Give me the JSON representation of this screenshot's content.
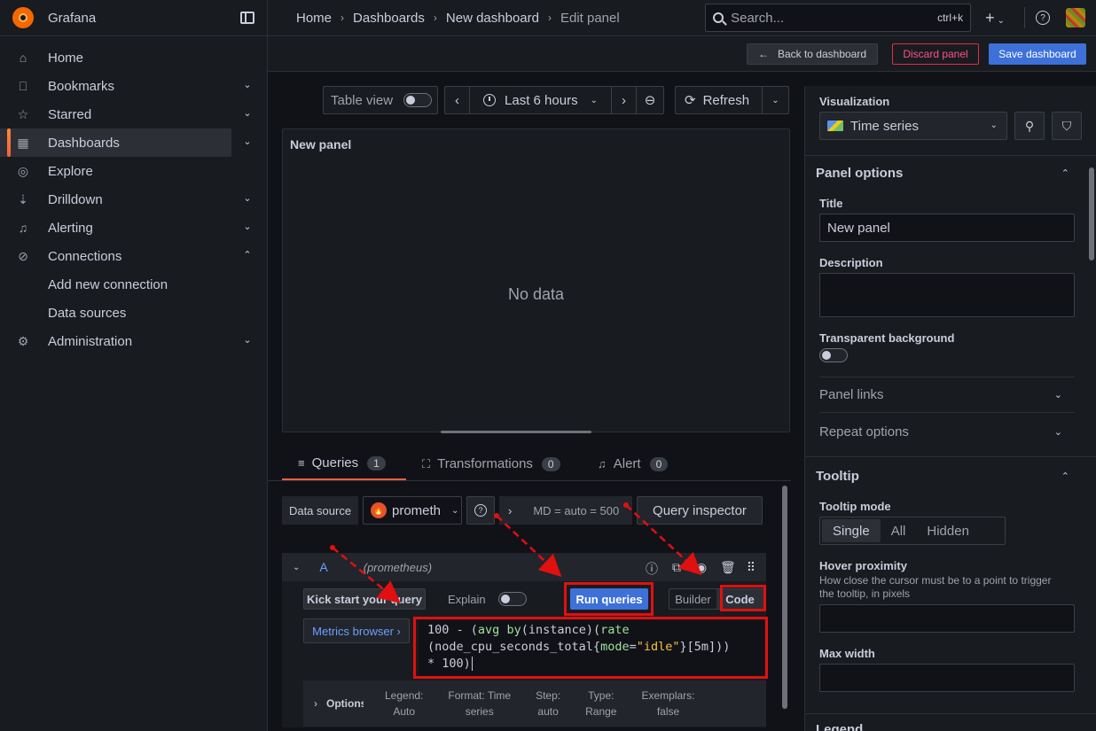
{
  "app": {
    "name": "Grafana"
  },
  "sidebar": {
    "items": [
      {
        "label": "Home",
        "icon": "home-icon",
        "chevron": ""
      },
      {
        "label": "Bookmarks",
        "icon": "bookmark-icon",
        "chevron": "⌄"
      },
      {
        "label": "Starred",
        "icon": "star-icon",
        "chevron": "⌄"
      },
      {
        "label": "Dashboards",
        "icon": "apps-icon",
        "chevron": "⌄"
      },
      {
        "label": "Explore",
        "icon": "compass-icon",
        "chevron": ""
      },
      {
        "label": "Drilldown",
        "icon": "drilldown-icon",
        "chevron": "⌄"
      },
      {
        "label": "Alerting",
        "icon": "bell-icon",
        "chevron": "⌄"
      },
      {
        "label": "Connections",
        "icon": "connections-icon",
        "chevron": "⌃"
      },
      {
        "label": "Add new connection"
      },
      {
        "label": "Data sources"
      },
      {
        "label": "Administration",
        "icon": "cog-icon",
        "chevron": "⌄"
      }
    ]
  },
  "breadcrumbs": [
    "Home",
    "Dashboards",
    "New dashboard",
    "Edit panel"
  ],
  "search": {
    "placeholder": "Search...",
    "shortcut": "ctrl+k"
  },
  "actions": {
    "back": "Back to dashboard",
    "discard": "Discard panel",
    "save": "Save dashboard"
  },
  "toolbar": {
    "table_view": "Table view",
    "time_range": "Last 6 hours",
    "refresh": "Refresh"
  },
  "panel": {
    "title": "New panel",
    "empty": "No data"
  },
  "tabs": [
    {
      "label": "Queries",
      "count": "1"
    },
    {
      "label": "Transformations",
      "count": "0"
    },
    {
      "label": "Alert",
      "count": "0"
    }
  ],
  "query": {
    "data_source_label": "Data source",
    "data_source": "prometh",
    "options_summary": "MD = auto = 500",
    "inspector": "Query inspector",
    "ref_id": "A",
    "ds_name": "(prometheus)",
    "kick_start": "Kick start your query",
    "explain": "Explain",
    "run": "Run queries",
    "builder": "Builder",
    "code": "Code",
    "metrics_browser": "Metrics browser ›",
    "expr": {
      "l1a": "100 - (",
      "l1b": "avg",
      "l1c": " ",
      "l1d": "by",
      "l1e": "(instance)(",
      "l1f": "rate",
      "l2a": "(node_cpu_seconds_total{",
      "l2b": "mode",
      "l2c": "=",
      "l2d": "\"idle\"",
      "l2e": "}[5m]))",
      "l3": "* 100)"
    },
    "options": {
      "title": "Options",
      "legend_k": "Legend:",
      "legend_v": "Auto",
      "format_k": "Format: Time",
      "format_v": "series",
      "step_k": "Step:",
      "step_v": "auto",
      "type_k": "Type:",
      "type_v": "Range",
      "exemplars_k": "Exemplars:",
      "exemplars_v": "false"
    }
  },
  "right": {
    "visualization_label": "Visualization",
    "visualization": "Time series",
    "panel_options": "Panel options",
    "title_label": "Title",
    "title_value": "New panel",
    "description_label": "Description",
    "transparent_label": "Transparent background",
    "panel_links": "Panel links",
    "repeat_options": "Repeat options",
    "tooltip": "Tooltip",
    "tooltip_mode_label": "Tooltip mode",
    "tooltip_modes": [
      "Single",
      "All",
      "Hidden"
    ],
    "hover_label": "Hover proximity",
    "hover_desc": "How close the cursor must be to a point to trigger the tooltip, in pixels",
    "max_width_label": "Max width",
    "legend": "Legend"
  },
  "colors": {
    "accent": "#3d71d9",
    "danger": "#e02f44",
    "annotation": "#e01010"
  }
}
